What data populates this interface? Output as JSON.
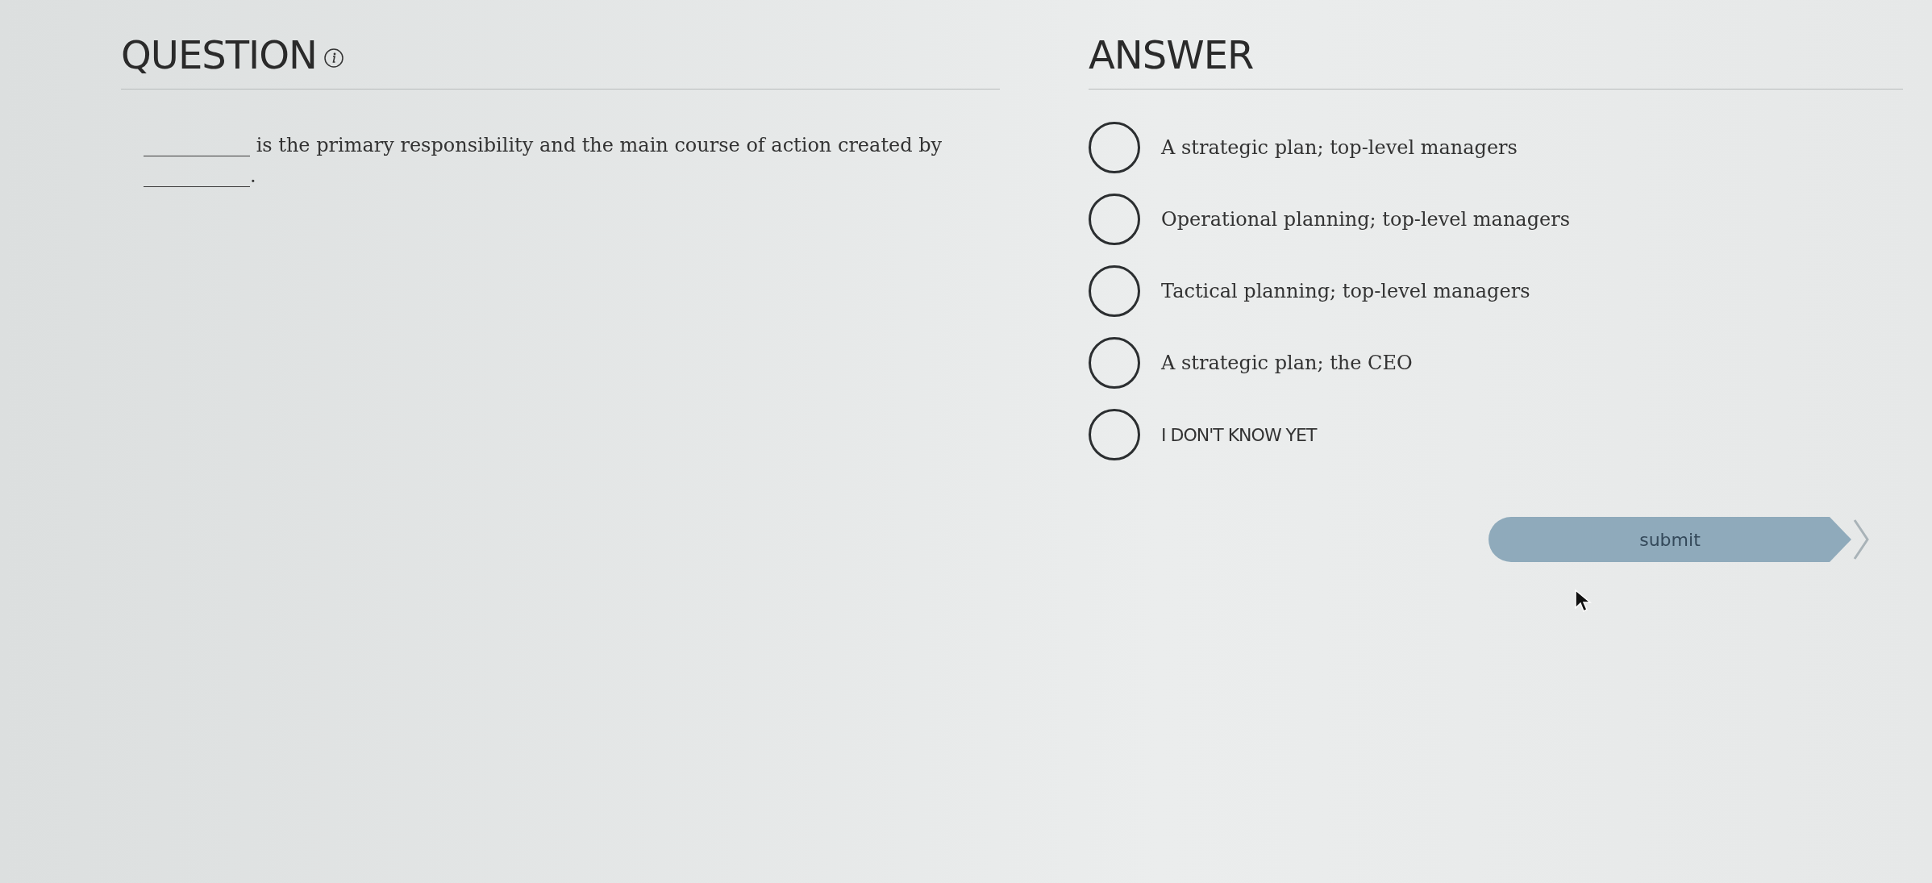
{
  "question": {
    "title": "QUESTION",
    "text": "___________ is the primary responsibility and the main course of action created by ___________."
  },
  "answer": {
    "title": "ANSWER",
    "options": [
      {
        "label": "A strategic plan; top-level managers",
        "selected": false,
        "kind": "choice"
      },
      {
        "label": "Operational planning; top-level managers",
        "selected": false,
        "kind": "choice"
      },
      {
        "label": "Tactical planning; top-level managers",
        "selected": false,
        "kind": "choice"
      },
      {
        "label": "A strategic plan; the CEO",
        "selected": false,
        "kind": "choice"
      },
      {
        "label": "I DON'T KNOW YET",
        "selected": false,
        "kind": "unsure"
      }
    ]
  },
  "submit": {
    "label": "submit"
  }
}
